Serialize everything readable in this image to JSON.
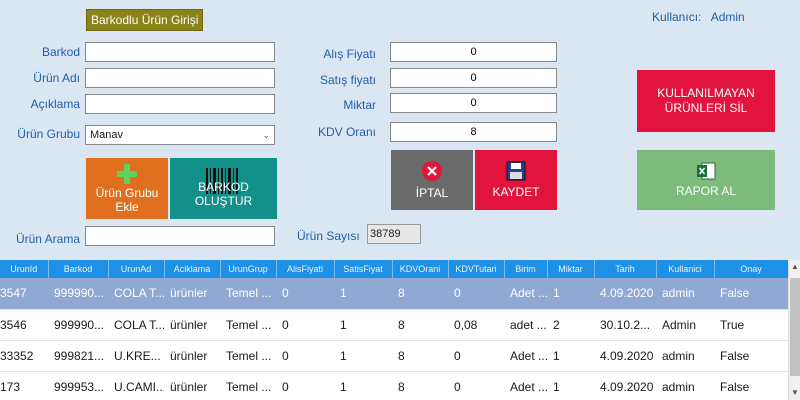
{
  "title_button": "Barkodlu Ürün Girişi",
  "user": {
    "label": "Kullanıcı:",
    "name": "Admin"
  },
  "left_fields": [
    {
      "label": "Barkod",
      "value": ""
    },
    {
      "label": "Ürün Adı",
      "value": ""
    },
    {
      "label": "Açıklama",
      "value": ""
    }
  ],
  "group": {
    "label": "Ürün Grubu",
    "value": "Manav"
  },
  "right_fields": [
    {
      "label": "Alış Fiyatı",
      "value": "0"
    },
    {
      "label": "Satış fiyatı",
      "value": "0"
    },
    {
      "label": "Miktar",
      "value": "0"
    },
    {
      "label": "KDV Oranı",
      "value": "8"
    }
  ],
  "buttons": {
    "urun_grubu": "Ürün Grubu Ekle",
    "barkod": "BARKOD OLUŞTUR",
    "iptal": "İPTAL",
    "kaydet": "KAYDET",
    "kullanilmayan": "KULLANILMAYAN ÜRÜNLERİ SİL",
    "rapor": "RAPOR AL"
  },
  "search": {
    "label": "Ürün Arama",
    "value": ""
  },
  "count": {
    "label": "Ürün Sayısı",
    "value": "38789"
  },
  "colors": {
    "grid_header": "#1e90e6",
    "selected_row": "#8fa9d2",
    "kaydet": "#e0143c",
    "iptal": "#6a6a6a",
    "ekle": "#e07020",
    "barkod": "#14908a",
    "rapor": "#7cbb7c"
  },
  "table": {
    "columns": [
      "UrunId",
      "Barkod",
      "UrunAd",
      "Aciklama",
      "UrunGrup",
      "AlisFiyati",
      "SatisFiyat",
      "KDVOrani",
      "KDVTutari",
      "Birim",
      "Miktar",
      "Tarih",
      "Kullanici",
      "Onay"
    ],
    "rows": [
      [
        "3547",
        "999990...",
        "COLA T...",
        "ürünler",
        "Temel ...",
        "0",
        "1",
        "8",
        "0",
        "Adet ...",
        "1",
        "4.09.2020",
        "admin",
        "False"
      ],
      [
        "3546",
        "999990...",
        "COLA T...",
        "ürünler",
        "Temel ...",
        "0",
        "1",
        "8",
        "0,08",
        "adet ...",
        "2",
        "30.10.2...",
        "Admin",
        "True"
      ],
      [
        "33352",
        "999821...",
        "U.KRE...",
        "ürünler",
        "Temel ...",
        "0",
        "1",
        "8",
        "0",
        "Adet ...",
        "1",
        "4.09.2020",
        "admin",
        "False"
      ],
      [
        "173",
        "999953...",
        "U.CAMI...",
        "ürünler",
        "Temel ...",
        "0",
        "1",
        "8",
        "0",
        "Adet ...",
        "1",
        "4.09.2020",
        "admin",
        "False"
      ]
    ]
  }
}
